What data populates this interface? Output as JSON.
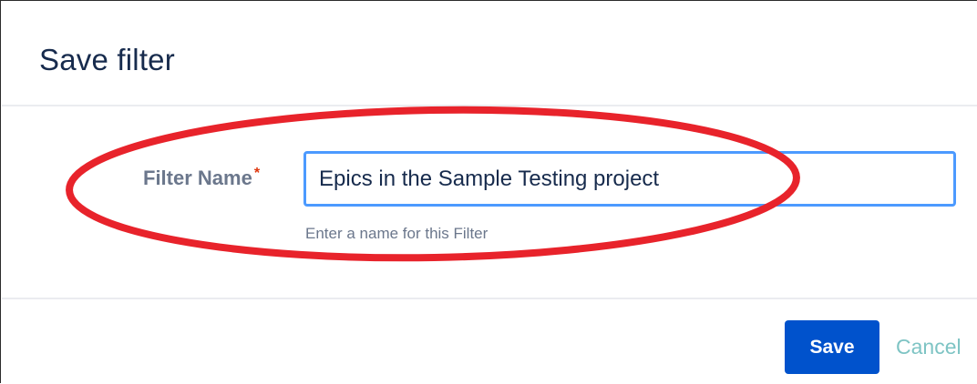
{
  "dialog": {
    "title": "Save filter"
  },
  "form": {
    "filter_name": {
      "label": "Filter Name",
      "required_marker": "*",
      "value": "Epics in the Sample Testing project",
      "help_text": "Enter a name for this Filter"
    }
  },
  "actions": {
    "save_label": "Save",
    "cancel_label": "Cancel"
  },
  "colors": {
    "primary_button": "#0052cc",
    "input_focus_border": "#4c9aff",
    "required_marker": "#de350b",
    "annotation_ellipse": "#e8232b",
    "cancel_link": "#7ec4c4"
  }
}
